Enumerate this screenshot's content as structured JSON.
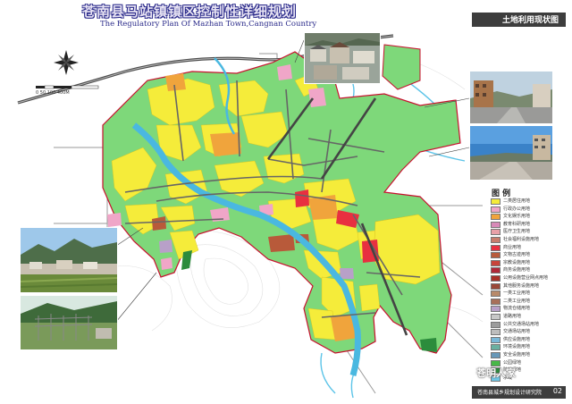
{
  "title": {
    "chinese": "苍南县马站镇镇区控制性详细规划",
    "english": "The Regulatory Plan Of Mazhan Town,Cangnan Country"
  },
  "sheet_title": "土地利用现状图",
  "scale_bar": {
    "label": "0  50 100    400M"
  },
  "legend": {
    "title": "图 例",
    "items": [
      {
        "label": "二类居住用地",
        "color": "#f5ec3a"
      },
      {
        "label": "行政办公用地",
        "color": "#f0a6c8"
      },
      {
        "label": "文化娱乐用地",
        "color": "#f0a43c"
      },
      {
        "label": "教育科研用地",
        "color": "#d88ab8"
      },
      {
        "label": "医疗卫生用地",
        "color": "#e8a0a8"
      },
      {
        "label": "社会福利设施用地",
        "color": "#c87c6c"
      },
      {
        "label": "商业用地",
        "color": "#e83040"
      },
      {
        "label": "文物古迹用地",
        "color": "#b85a3a"
      },
      {
        "label": "宗教设施用地",
        "color": "#c8443a"
      },
      {
        "label": "商务设施用地",
        "color": "#b02838"
      },
      {
        "label": "公用设施营业网点用地",
        "color": "#a83028"
      },
      {
        "label": "其他服务设施用地",
        "color": "#9a4838"
      },
      {
        "label": "一类工业用地",
        "color": "#b88a6a"
      },
      {
        "label": "二类工业用地",
        "color": "#a8705a"
      },
      {
        "label": "物流仓储用地",
        "color": "#b8a0c8"
      },
      {
        "label": "道路用地",
        "color": "#c8c8c8"
      },
      {
        "label": "公共交通场站用地",
        "color": "#9c9c9c"
      },
      {
        "label": "交通场站用地",
        "color": "#bdbdbd"
      },
      {
        "label": "供应设施用地",
        "color": "#7ab8d8"
      },
      {
        "label": "环境设施用地",
        "color": "#6ab0a0"
      },
      {
        "label": "安全设施用地",
        "color": "#6898b8"
      },
      {
        "label": "公园绿地",
        "color": "#48b848"
      },
      {
        "label": "防护绿地",
        "color": "#2c8c3c"
      },
      {
        "label": "水域",
        "color": "#6ec8e8"
      }
    ]
  },
  "footer": {
    "organization": "苍南县城乡规划设计研究院",
    "page_number": "02"
  },
  "watermark": "苍明人家",
  "colors": {
    "residential": "#f5ec3a",
    "green_land": "#7ed87a",
    "water": "#4ab8e0",
    "road": "#555555",
    "plan_boundary": "#c8102e",
    "banner": "#3d3d3d"
  }
}
